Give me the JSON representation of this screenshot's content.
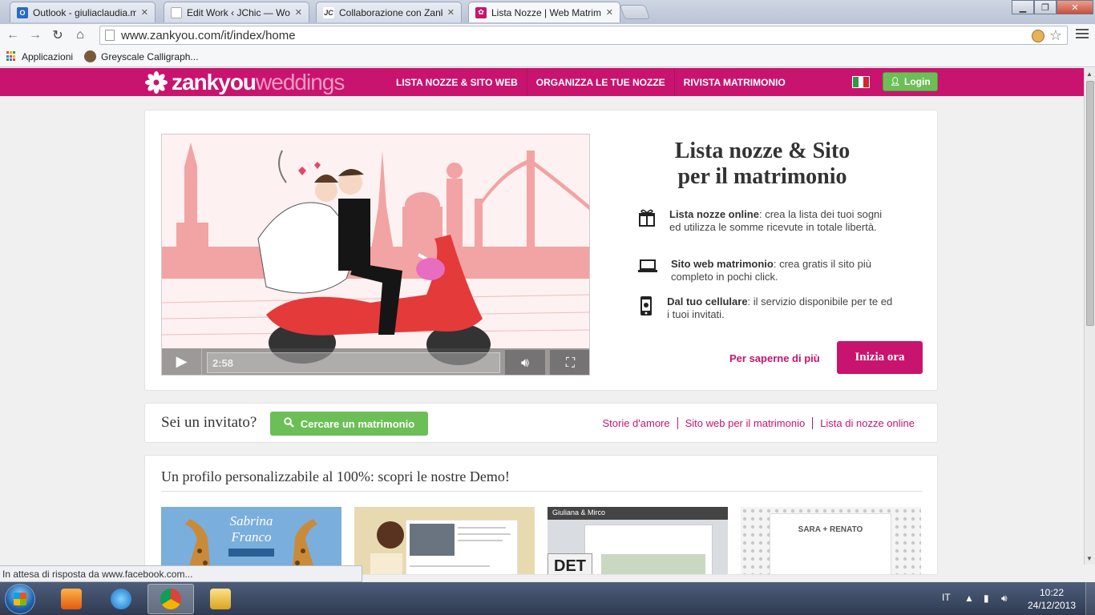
{
  "browser": {
    "tabs": [
      {
        "title": "Outlook - giuliaclaudia.m",
        "favicon_color": "#2a6bc4",
        "favicon_glyph": "O",
        "active": false
      },
      {
        "title": "Edit Work ‹ JChic — Word",
        "favicon_color": "#ffffff",
        "favicon_glyph": "",
        "active": false
      },
      {
        "title": "Collaborazione con Zanky",
        "favicon_color": "#ffffff",
        "favicon_glyph": "JC",
        "active": false
      },
      {
        "title": "Lista Nozze | Web Matrim",
        "favicon_color": "#c8146e",
        "favicon_glyph": "✿",
        "active": true
      }
    ],
    "url": "www.zankyou.com/it/index/home",
    "bookmarks": [
      {
        "label": "Applicazioni",
        "icon": "apps-grid-icon"
      },
      {
        "label": "Greyscale Calligraph...",
        "icon": "avatar-icon"
      }
    ],
    "status_text": "In attesa di risposta da www.facebook.com..."
  },
  "site": {
    "logo": {
      "part1": "zankyou",
      "part2": "weddings"
    },
    "nav": [
      "LISTA NOZZE & SITO WEB",
      "ORGANIZZA LE TUE NOZZE",
      "RIVISTA MATRIMONIO"
    ],
    "login_label": "Login",
    "brand_color": "#c8146e",
    "green_color": "#6cbf56"
  },
  "hero": {
    "video_time": "2:58",
    "title_line1": "Lista nozze & Sito",
    "title_line2": "per il matrimonio",
    "features": [
      {
        "icon": "gift-icon",
        "bold": "Lista nozze online",
        "text": ": crea la lista dei tuoi sogni ed utilizza le somme ricevute in totale libertà."
      },
      {
        "icon": "laptop-icon",
        "bold": "Sito web matrimonio",
        "text": ": crea gratis il sito più completo in pochi click."
      },
      {
        "icon": "smartphone-icon",
        "bold": "Dal tuo cellulare",
        "text": ": il servizio disponibile per te ed i tuoi invitati."
      }
    ],
    "more_link": "Per saperne di più",
    "cta": "Inizia ora"
  },
  "guest": {
    "question": "Sei un invitato?",
    "search_button": "Cercare un matrimonio",
    "links": [
      "Storie d'amore",
      "Sito web per il matrimonio",
      "Lista di nozze online"
    ]
  },
  "demo": {
    "title": "Un profilo personalizzabile al 100%: scopri le nostre Demo!",
    "thumb1_names": "Sabrina\nFranco",
    "thumb3_label": "Giuliana & Mirco",
    "thumb3_plate": "DET",
    "thumb4_names": "SARA + RENATO"
  },
  "taskbar": {
    "language": "IT",
    "time": "10:22",
    "date": "24/12/2013"
  }
}
